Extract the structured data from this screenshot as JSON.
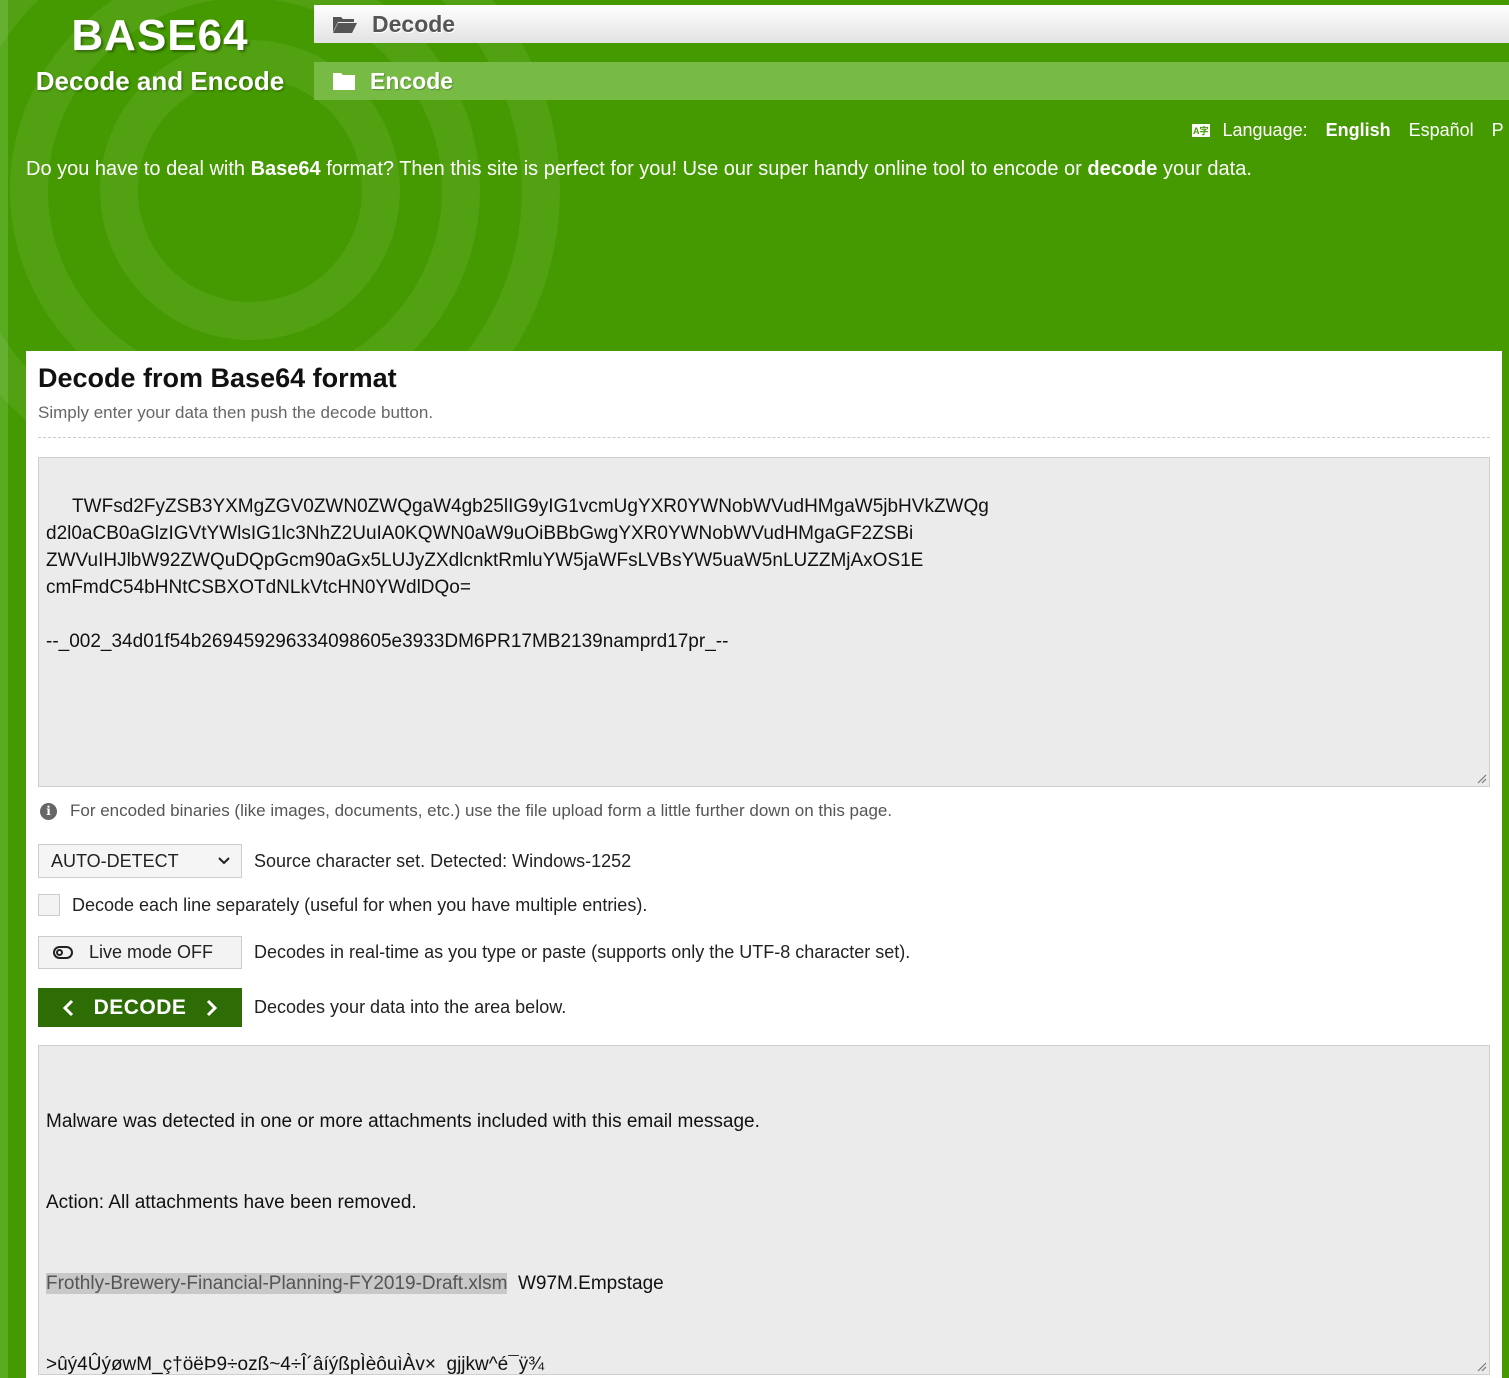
{
  "brand": {
    "title": "BASE64",
    "subtitle": "Decode and Encode"
  },
  "nav": {
    "decode_label": "Decode",
    "encode_label": "Encode"
  },
  "language": {
    "icon": "language-icon",
    "label": "Language:",
    "options": [
      "English",
      "Español",
      "P"
    ],
    "selected": "English"
  },
  "intro": {
    "part1": "Do you have to deal with ",
    "bold1": "Base64",
    "part2": " format? Then this site is perfect for you! Use our super handy online tool to encode or ",
    "bold2": "decode",
    "part3": " your data."
  },
  "panel": {
    "heading": "Decode from Base64 format",
    "hint": "Simply enter your data then push the decode button.",
    "input_text": " TWFsd2FyZSB3YXMgZGV0ZWN0ZWQgaW4gb25lIG9yIG1vcmUgYXR0YWNobWVudHMgaW5jbHVkZWQg\nd2l0aCB0aGlzIGVtYWlsIG1lc3NhZ2UuIA0KQWN0aW9uOiBBbGwgYXR0YWNobWVudHMgaGF2ZSBi\nZWVuIHJlbW92ZWQuDQpGcm90aGx5LUJyZXdlcnktRmluYW5jaWFsLVBsYW5uaW5nLUZZMjAxOS1E\ncmFmdC54bHNtCSBXOTdNLkVtcHN0YWdlDQo=\n\n--_002_34d01f54b269459296334098605e3933DM6PR17MB2139namprd17pr_--",
    "info_text": "For encoded binaries (like images, documents, etc.) use the file upload form a little further down on this page.",
    "charset_selected": "AUTO-DETECT",
    "charset_desc": "Source character set. Detected: Windows-1252",
    "line_by_line_label": "Decode each line separately (useful for when you have multiple entries).",
    "live_mode_label": "Live mode OFF",
    "live_mode_desc": "Decodes in real-time as you type or paste (supports only the UTF-8 character set).",
    "decode_button": "DECODE",
    "decode_desc": "Decodes your data into the area below.",
    "output": {
      "line1": "Malware was detected in one or more attachments included with this email message.",
      "line2": "Action: All attachments have been removed.",
      "filename": "Frothly-Brewery-Financial-Planning-FY2019-Draft.xlsm",
      "after_filename": "  W97M.Empstage",
      "line4": ">ûý4ÛýøwM_ç†öëÞ9÷ozß~4÷Î´âíýßpÌèôuìÀv×  gjjkw^é¯ÿ¾"
    }
  },
  "colors": {
    "background": "#449a00",
    "decode_button": "#2e6d06",
    "encode_tab": "#77bb44"
  }
}
